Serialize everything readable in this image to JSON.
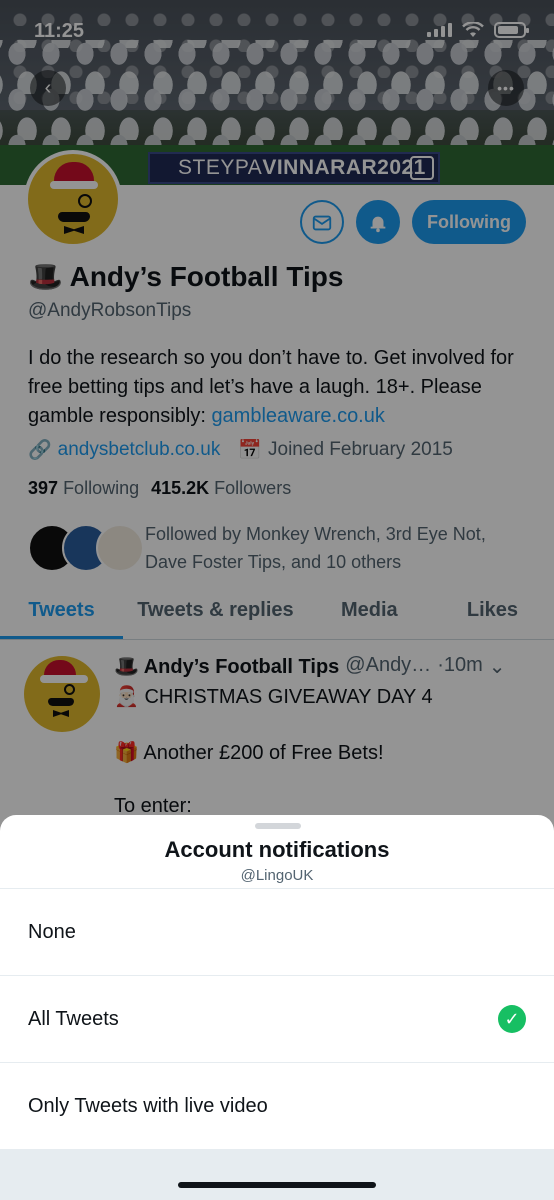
{
  "status_bar": {
    "time": "11:25"
  },
  "banner": {
    "board_text_thin": "STEYPA",
    "board_text_bold": "VINNARAR2021"
  },
  "profile": {
    "name": "🎩 Andy’s Football Tips",
    "handle": "@AndyRobsonTips",
    "bio_text": "I do the research so you don’t have to. Get involved for free betting tips and let’s have a laugh. 18+. Please gamble responsibly: ",
    "bio_link": "gambleaware.co.uk",
    "website": "andysbetclub.co.uk",
    "joined": "Joined February 2015",
    "following_count": "397",
    "following_label": "Following",
    "followers_count": "415.2K",
    "followers_label": "Followers",
    "followed_by": "Followed by Monkey Wrench, 3rd Eye Not, Dave Foster Tips, and 10 others",
    "following_button": "Following"
  },
  "tabs": [
    "Tweets",
    "Tweets & replies",
    "Media",
    "Likes"
  ],
  "tweet": {
    "author": "🎩 Andy’s Football Tips",
    "handle": "@Andy…",
    "time": "·10m",
    "line1": "🎅🏻 CHRISTMAS GIVEAWAY DAY 4",
    "line2": "🎁 Another £200 of Free Bets!",
    "line3": "To enter:"
  },
  "sheet": {
    "title": "Account notifications",
    "subtitle": "@LingoUK",
    "options": [
      {
        "label": "None",
        "selected": false
      },
      {
        "label": "All Tweets",
        "selected": true
      },
      {
        "label": "Only Tweets with live video",
        "selected": false
      }
    ]
  },
  "colors": {
    "accent": "#1d9bf0",
    "check": "#17bf63"
  }
}
